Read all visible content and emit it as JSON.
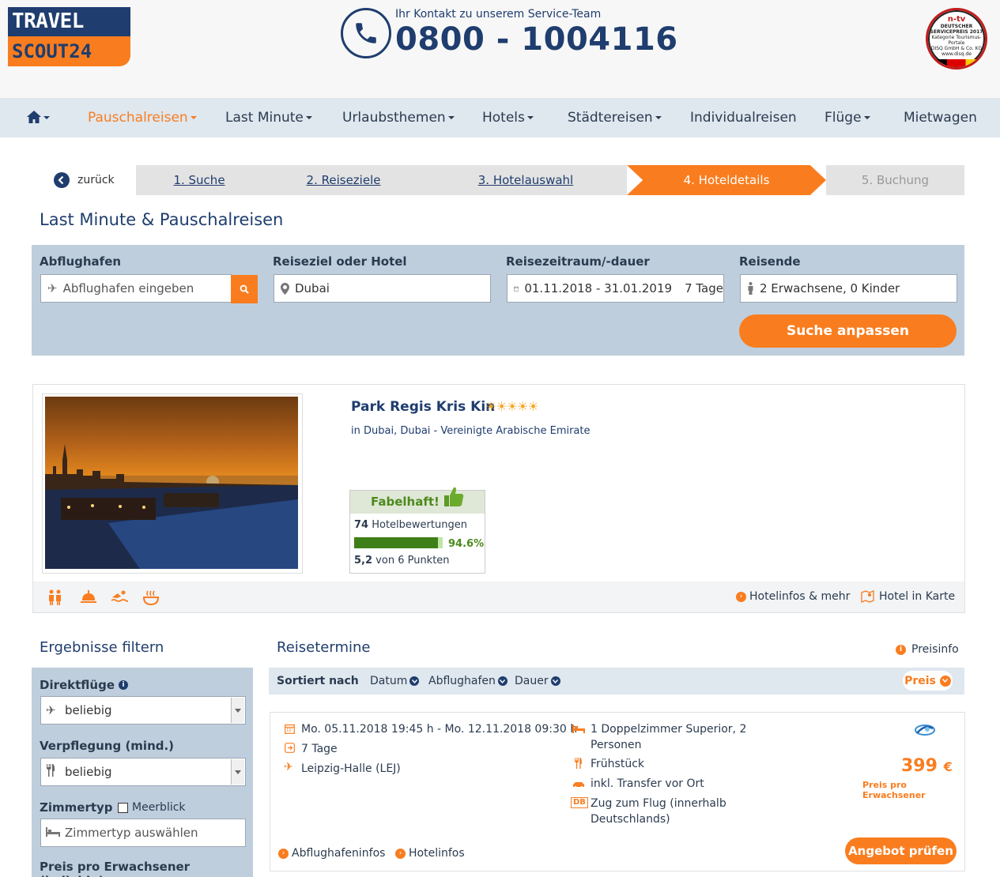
{
  "header": {
    "logo_line1": "TRAVEL",
    "logo_line2": "SCOUT24",
    "contact_label": "Ihr Kontakt zu unserem Service-Team",
    "phone": "0800 - 1004116",
    "award": {
      "brand": "n-tv",
      "line1": "DEUTSCHER",
      "line2": "SERVICEPREIS 2017",
      "line3": "Kategorie Tourismus-Portale",
      "line4": "DISQ GmbH & Co. KG",
      "line5": "www.disq.de"
    }
  },
  "nav": {
    "items": [
      {
        "label": "Pauschalreisen",
        "active": true
      },
      {
        "label": "Last Minute"
      },
      {
        "label": "Urlaubsthemen"
      },
      {
        "label": "Hotels"
      },
      {
        "label": "Städtereisen"
      },
      {
        "label": "Individualreisen"
      },
      {
        "label": "Flüge"
      },
      {
        "label": "Mietwagen"
      }
    ]
  },
  "steps": {
    "back": "zurück",
    "items": [
      "1. Suche",
      "2. Reiseziele",
      "3. Hotelauswahl",
      "4. Hoteldetails",
      "5. Buchung"
    ]
  },
  "page_title": "Last Minute & Pauschalreisen",
  "search": {
    "airport_label": "Abflughafen",
    "airport_placeholder": "Abflughafen eingeben",
    "destination_label": "Reiseziel oder Hotel",
    "destination_value": "Dubai",
    "period_label": "Reisezeitraum/-dauer",
    "period_value": "01.11.2018 - 31.01.2019",
    "duration_value": "7 Tage",
    "travelers_label": "Reisende",
    "travelers_value": "2 Erwachsene, 0 Kinder",
    "submit": "Suche anpassen"
  },
  "hotel": {
    "name": "Park Regis Kris Kin",
    "stars": "☀☀☀☀☀",
    "location": "in Dubai, Dubai - Vereinigte Arabische Emirate",
    "rating": {
      "label": "Fabelhaft!",
      "count": "74",
      "count_label": "Hotelbewertungen",
      "percent_value": 94.6,
      "percent": "94.6%",
      "points": "5,2",
      "points_label": "von 6 Punkten"
    },
    "link_infos": "Hotelinfos & mehr",
    "link_map": "Hotel in Karte"
  },
  "filters": {
    "title": "Ergebnisse filtern",
    "direct_label": "Direktflüge",
    "direct_value": "beliebig",
    "board_label": "Verpflegung (mind.)",
    "board_value": "beliebig",
    "room_label": "Zimmertyp",
    "seaview_label": "Meerblick",
    "room_placeholder": "Zimmertyp auswählen",
    "price_label": "Preis pro Erwachsener (beliebig)"
  },
  "results": {
    "title": "Reisetermine",
    "preisinfo": "Preisinfo",
    "sort_label": "Sortiert nach",
    "sort_date": "Datum",
    "sort_airport": "Abflughafen",
    "sort_duration": "Dauer",
    "sort_price": "Preis",
    "offer": {
      "dates": "Mo. 05.11.2018 19:45 h - Mo. 12.11.2018 09:30 h",
      "duration": "7 Tage",
      "airport": "Leipzig-Halle (LEJ)",
      "room_line1": "1 Doppelzimmer Superior, 2",
      "room_line2": "Personen",
      "board": "Frühstück",
      "transfer": "inkl. Transfer vor Ort",
      "train_badge": "DB",
      "train_line1": "Zug zum Flug (innerhalb",
      "train_line2": "Deutschlands)",
      "price": "399",
      "currency": "€",
      "price_note": "Preis pro Erwachsener",
      "button": "Angebot prüfen",
      "link_airport": "Abflughafeninfos",
      "link_hotel": "Hotelinfos"
    }
  },
  "colors": {
    "brand_blue": "#1f3d6e",
    "brand_orange": "#f97d1f",
    "rating_green": "#4c8a1c"
  }
}
